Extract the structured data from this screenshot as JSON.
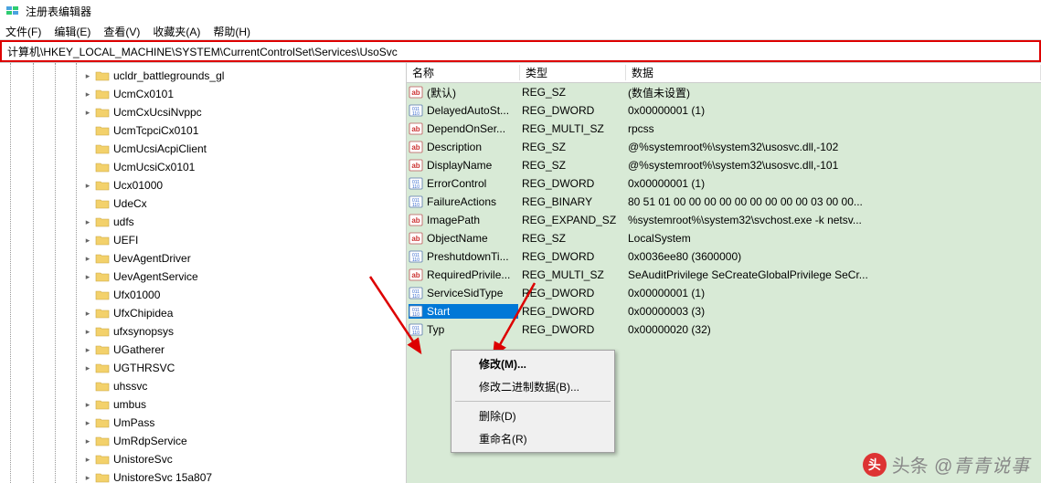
{
  "window": {
    "title": "注册表编辑器"
  },
  "menus": [
    "文件(F)",
    "编辑(E)",
    "查看(V)",
    "收藏夹(A)",
    "帮助(H)"
  ],
  "address": "计算机\\HKEY_LOCAL_MACHINE\\SYSTEM\\CurrentControlSet\\Services\\UsoSvc",
  "tree": [
    {
      "label": "ucldr_battlegrounds_gl",
      "exp": ">"
    },
    {
      "label": "UcmCx0101",
      "exp": ">"
    },
    {
      "label": "UcmCxUcsiNvppc",
      "exp": ">"
    },
    {
      "label": "UcmTcpciCx0101",
      "exp": ""
    },
    {
      "label": "UcmUcsiAcpiClient",
      "exp": ""
    },
    {
      "label": "UcmUcsiCx0101",
      "exp": ""
    },
    {
      "label": "Ucx01000",
      "exp": ">"
    },
    {
      "label": "UdeCx",
      "exp": ""
    },
    {
      "label": "udfs",
      "exp": ">"
    },
    {
      "label": "UEFI",
      "exp": ">"
    },
    {
      "label": "UevAgentDriver",
      "exp": ">"
    },
    {
      "label": "UevAgentService",
      "exp": ">"
    },
    {
      "label": "Ufx01000",
      "exp": ""
    },
    {
      "label": "UfxChipidea",
      "exp": ">"
    },
    {
      "label": "ufxsynopsys",
      "exp": ">"
    },
    {
      "label": "UGatherer",
      "exp": ">"
    },
    {
      "label": "UGTHRSVC",
      "exp": ">"
    },
    {
      "label": "uhssvc",
      "exp": ""
    },
    {
      "label": "umbus",
      "exp": ">"
    },
    {
      "label": "UmPass",
      "exp": ">"
    },
    {
      "label": "UmRdpService",
      "exp": ">"
    },
    {
      "label": "UnistoreSvc",
      "exp": ">"
    },
    {
      "label": "UnistoreSvc 15a807",
      "exp": ">"
    }
  ],
  "columns": {
    "name": "名称",
    "type": "类型",
    "data": "数据"
  },
  "values": [
    {
      "icon": "ab",
      "name": "(默认)",
      "type": "REG_SZ",
      "data": "(数值未设置)"
    },
    {
      "icon": "bin",
      "name": "DelayedAutoSt...",
      "type": "REG_DWORD",
      "data": "0x00000001 (1)"
    },
    {
      "icon": "ab",
      "name": "DependOnSer...",
      "type": "REG_MULTI_SZ",
      "data": "rpcss"
    },
    {
      "icon": "ab",
      "name": "Description",
      "type": "REG_SZ",
      "data": "@%systemroot%\\system32\\usosvc.dll,-102"
    },
    {
      "icon": "ab",
      "name": "DisplayName",
      "type": "REG_SZ",
      "data": "@%systemroot%\\system32\\usosvc.dll,-101"
    },
    {
      "icon": "bin",
      "name": "ErrorControl",
      "type": "REG_DWORD",
      "data": "0x00000001 (1)"
    },
    {
      "icon": "bin",
      "name": "FailureActions",
      "type": "REG_BINARY",
      "data": "80 51 01 00 00 00 00 00 00 00 00 00 03 00 00..."
    },
    {
      "icon": "ab",
      "name": "ImagePath",
      "type": "REG_EXPAND_SZ",
      "data": "%systemroot%\\system32\\svchost.exe -k netsv..."
    },
    {
      "icon": "ab",
      "name": "ObjectName",
      "type": "REG_SZ",
      "data": "LocalSystem"
    },
    {
      "icon": "bin",
      "name": "PreshutdownTi...",
      "type": "REG_DWORD",
      "data": "0x0036ee80 (3600000)"
    },
    {
      "icon": "ab",
      "name": "RequiredPrivile...",
      "type": "REG_MULTI_SZ",
      "data": "SeAuditPrivilege SeCreateGlobalPrivilege SeCr..."
    },
    {
      "icon": "bin",
      "name": "ServiceSidType",
      "type": "REG_DWORD",
      "data": "0x00000001 (1)"
    },
    {
      "icon": "bin",
      "name": "Start",
      "type": "REG_DWORD",
      "data": "0x00000003 (3)",
      "selected": true
    },
    {
      "icon": "bin",
      "name": "Typ",
      "type": "REG_DWORD",
      "data": "0x00000020 (32)"
    }
  ],
  "context_menu": {
    "items": [
      {
        "label": "修改(M)...",
        "bold": true
      },
      {
        "label": "修改二进制数据(B)..."
      },
      {
        "sep": true
      },
      {
        "label": "删除(D)"
      },
      {
        "label": "重命名(R)"
      }
    ]
  },
  "watermark": {
    "text": "@青青说事",
    "prefix": "头条"
  }
}
